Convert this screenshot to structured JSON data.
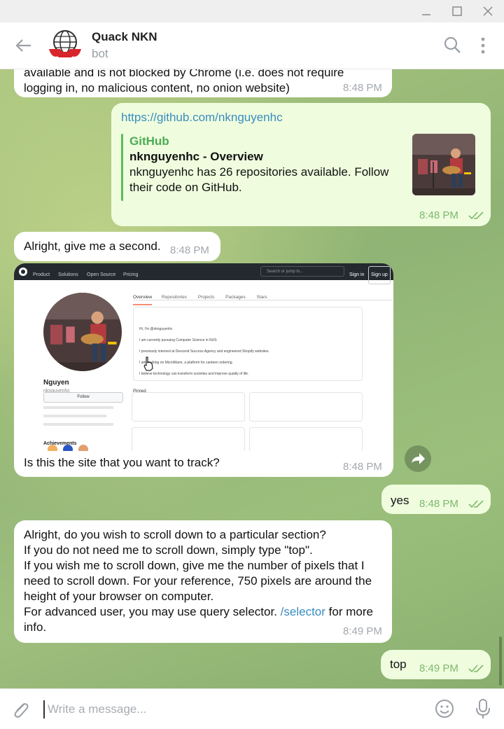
{
  "chat": {
    "title": "Quack NKN",
    "subtitle": "bot"
  },
  "icons": {
    "back": "back-arrow-icon",
    "search": "search-icon",
    "menu": "more-vertical-icon",
    "attach": "paperclip-icon",
    "emoji": "emoji-icon",
    "mic": "microphone-icon",
    "share": "forward-icon"
  },
  "colors": {
    "outgoing_bubble": "#effdde",
    "incoming_bubble": "#ffffff",
    "link": "#3a8cc1",
    "preview_accent": "#5cbb5c"
  },
  "messages": [
    {
      "direction": "in",
      "text_line1": "available and is not blocked by Chrome (i.e. does not require",
      "text_line2": "logging in, no malicious content, no onion website)",
      "time": "8:48 PM"
    },
    {
      "direction": "out",
      "link": "https://github.com/nkngu​yenhc",
      "preview": {
        "site": "GitHub",
        "title": "nkng​uyenhc - Overview",
        "description": "nkng​uyenhc has 26 repositories available. Follow their code on GitHub."
      },
      "time": "8:48 PM"
    },
    {
      "direction": "in",
      "text": "Alright, give me a second.",
      "time": "8:48 PM"
    },
    {
      "direction": "in",
      "caption": "Is this the site that you want to track?",
      "time": "8:48 PM",
      "screenshot": {
        "nav": [
          "Product",
          "Solutions",
          "Open Source",
          "Pricing"
        ],
        "search_placeholder": "Search or jump to...",
        "sign_in": "Sign in",
        "sign_up": "Sign up",
        "tabs": [
          "Overview",
          "Repositories",
          "Projects",
          "Packages",
          "Stars"
        ],
        "profile_name": "Nguyen",
        "profile_handle": "nkng​uyenhc",
        "follow_label": "Follow",
        "readme_lines": [
          "Hi, I'm @nkng​uyenhc",
          "I am currently pursuing Computer Science in NUS",
          "I previously interned at Descend Success Agency and engineered Shopify websites.",
          "I am working on MicroMann, a platform for canteen ordering.",
          "I believe technology can transform societies and improve quality of life."
        ],
        "pinned_label": "Pinned",
        "achievements_label": "Achievements"
      }
    },
    {
      "direction": "out",
      "text": "yes",
      "time": "8:48 PM"
    },
    {
      "direction": "in",
      "line1": "Alright, do you wish to scroll down to a particular section?",
      "line2": "If you do not need me to scroll down, simply type \"top\".",
      "line3": "If you wish me to scroll down, give me the number of pixels that I",
      "line4": "need to scroll down. For your reference, 750 pixels are around the",
      "line5": "height of your browser on computer.",
      "line6_start": "For advanced user, you may use query selector.",
      "line6_link": "/selector",
      "line6_end": "for more",
      "line7": "info.",
      "time": "8:49 PM"
    },
    {
      "direction": "out",
      "text": "top",
      "time": "8:49 PM"
    }
  ],
  "composer": {
    "placeholder": "Write a message..."
  }
}
